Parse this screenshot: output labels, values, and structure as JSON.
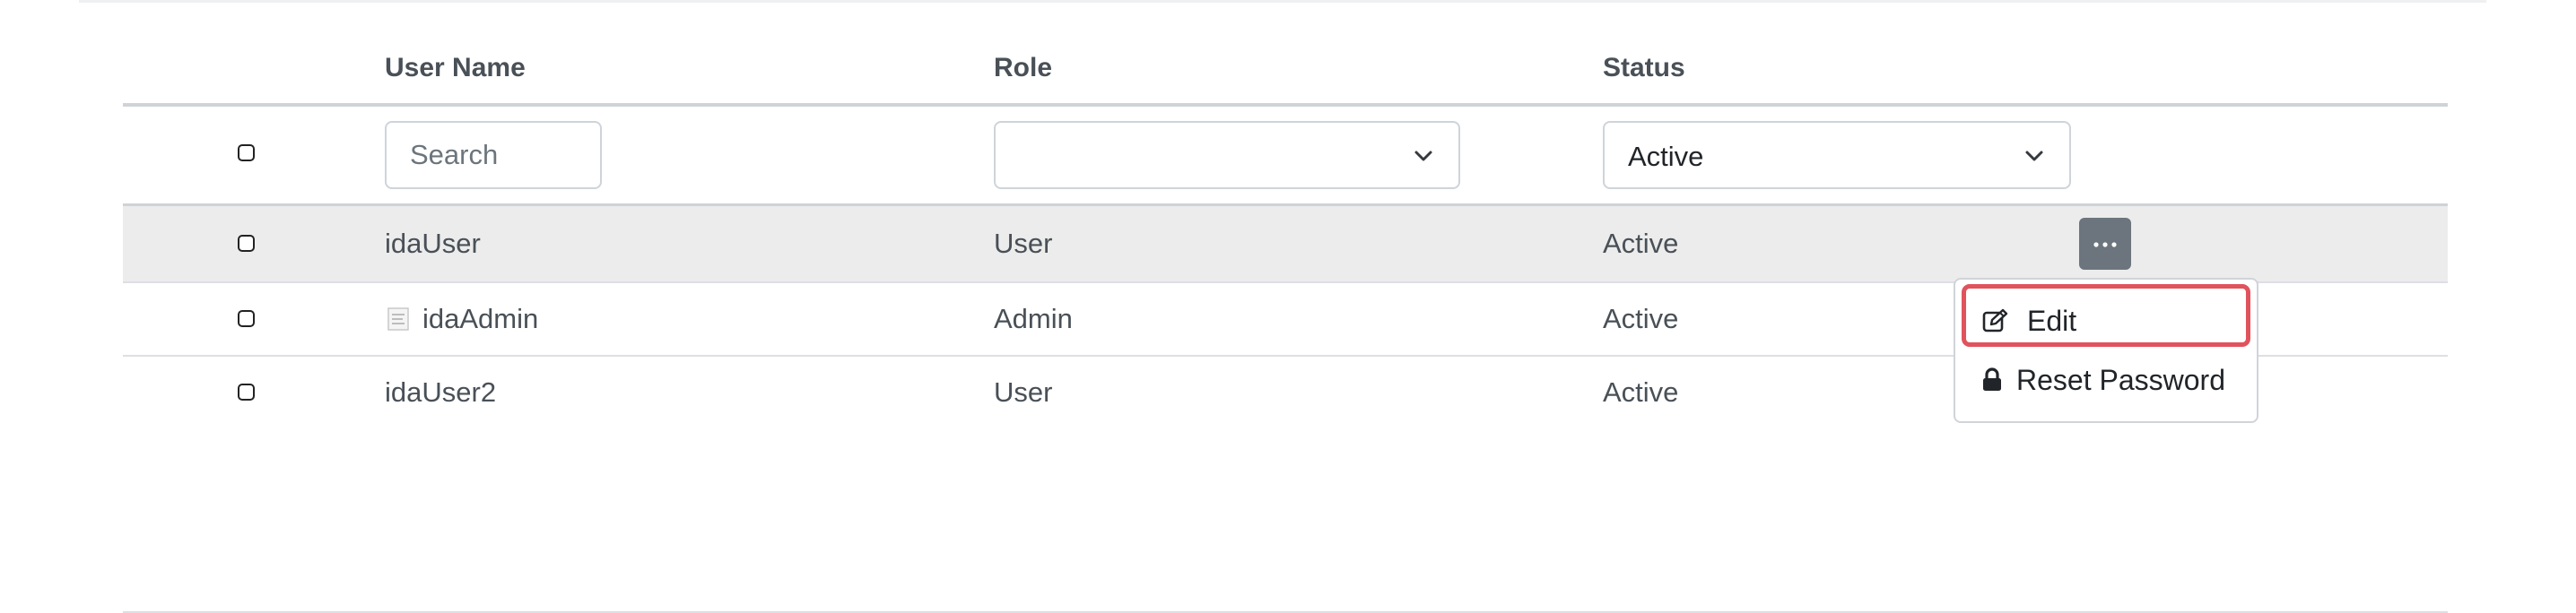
{
  "table": {
    "headers": {
      "user_name": "User Name",
      "role": "Role",
      "status": "Status"
    },
    "filters": {
      "search_placeholder": "Search",
      "role_value": "",
      "status_value": "Active"
    },
    "rows": [
      {
        "user_name": "idaUser",
        "role": "User",
        "status": "Active"
      },
      {
        "user_name": "idaAdmin",
        "role": "Admin",
        "status": "Active"
      },
      {
        "user_name": "idaUser2",
        "role": "User",
        "status": "Active"
      }
    ]
  },
  "row_menu": {
    "edit_label": "Edit",
    "reset_password_label": "Reset Password"
  },
  "colors": {
    "highlight_row": "#ececec",
    "more_button": "#6c757d",
    "focus_outline": "#e0535d"
  },
  "icons": {
    "more": "ellipsis-icon",
    "edit": "edit-icon",
    "reset_password": "lock-icon",
    "broken_avatar": "broken-image-icon"
  }
}
